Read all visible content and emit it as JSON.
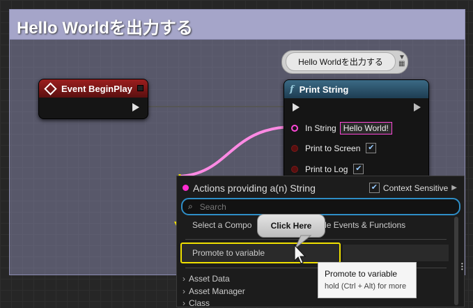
{
  "comment": {
    "title": "Hello Worldを出力する"
  },
  "bubble": {
    "text": "Hello Worldを出力する"
  },
  "event_node": {
    "title": "Event BeginPlay",
    "icon": "event-diamond-icon",
    "color": "#9c1e1e"
  },
  "print_node": {
    "title": "Print String",
    "icon": "function-icon",
    "color": "#3b6a85",
    "pins": {
      "in_string": {
        "label": "In String",
        "value": "Hello World!"
      },
      "print_to_screen": {
        "label": "Print to Screen",
        "checked": true
      },
      "print_to_log": {
        "label": "Print to Log",
        "checked": true
      }
    }
  },
  "menu": {
    "header": "Actions providing a(n) String",
    "context_sensitive": {
      "label": "Context Sensitive",
      "checked": true
    },
    "search": {
      "placeholder": "Search"
    },
    "items": {
      "select_component": "Select a Compo",
      "select_component_tail": "ble Events & Functions",
      "promote": "Promote to variable"
    },
    "categories": [
      "Asset Data",
      "Asset Manager",
      "Class"
    ]
  },
  "callout": {
    "text": "Click Here"
  },
  "tooltip": {
    "title": "Promote to variable",
    "hint": "hold (Ctrl + Alt) for more"
  },
  "colors": {
    "string_pin": "#ff48d8",
    "highlight": "#f0e000",
    "accent": "#2e8ec7"
  }
}
